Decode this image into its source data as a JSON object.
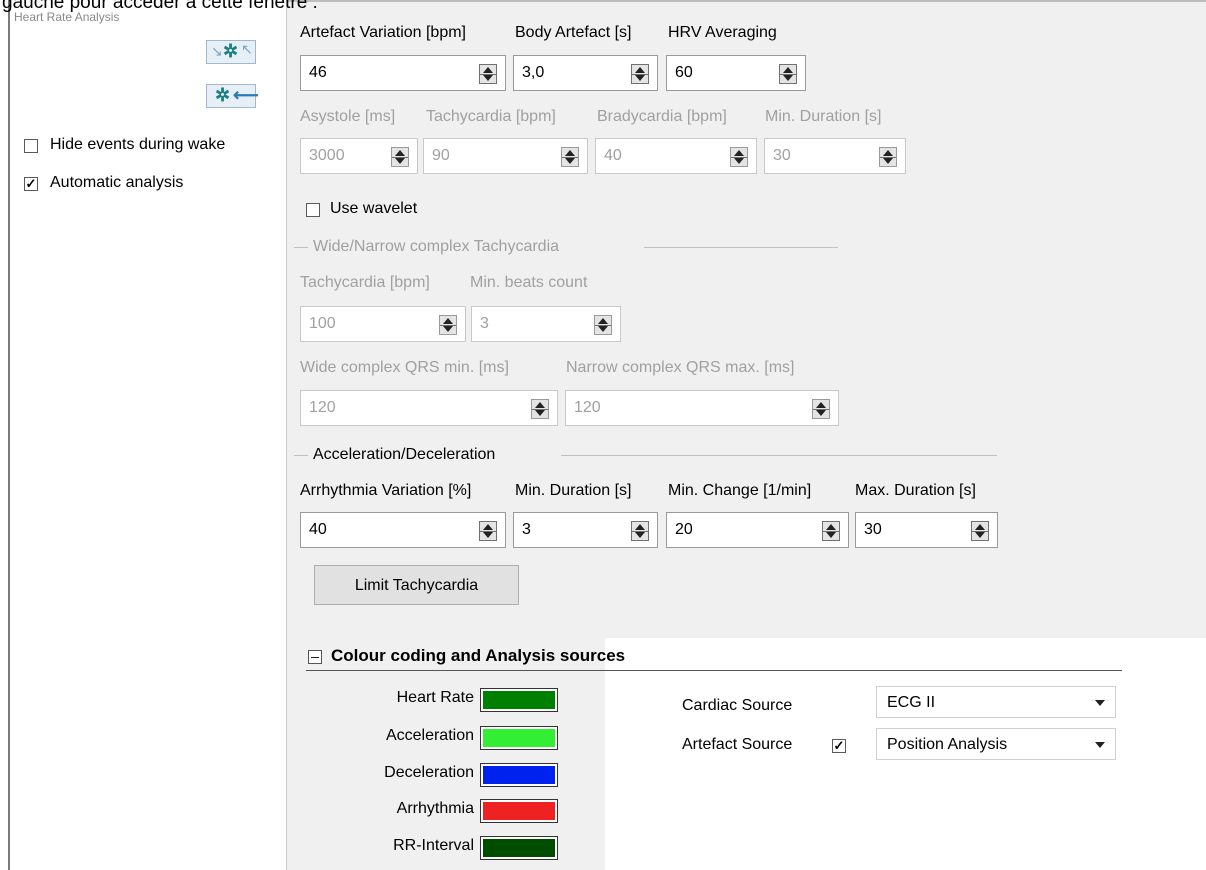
{
  "overlay_text": "gauche pour accéder à cette fenêtre :",
  "left_panel": {
    "title": "Heart Rate Analysis",
    "hide_events_label": "Hide events during wake",
    "hide_events_checked": false,
    "automatic_analysis_label": "Automatic analysis",
    "automatic_analysis_checked": true
  },
  "row1": {
    "labels": [
      "Artefact Variation [bpm]",
      "Body Artefact [s]",
      "HRV Averaging"
    ],
    "values": [
      "46",
      "3,0",
      "60"
    ]
  },
  "row2": {
    "labels": [
      "Asystole [ms]",
      "Tachycardia [bpm]",
      "Bradycardia [bpm]",
      "Min. Duration [s]"
    ],
    "values": [
      "3000",
      "90",
      "40",
      "30"
    ]
  },
  "use_wavelet": {
    "label": "Use wavelet",
    "checked": false
  },
  "wide_narrow": {
    "group_title": "Wide/Narrow complex Tachycardia",
    "labels_a": [
      "Tachycardia [bpm]",
      "Min. beats count"
    ],
    "values_a": [
      "100",
      "3"
    ],
    "labels_b": [
      "Wide complex QRS min. [ms]",
      "Narrow complex QRS max. [ms]"
    ],
    "values_b": [
      "120",
      "120"
    ]
  },
  "accel": {
    "group_title": "Acceleration/Deceleration",
    "labels": [
      "Arrhythmia Variation [%]",
      "Min. Duration [s]",
      "Min. Change [1/min]",
      "Max. Duration [s]"
    ],
    "values": [
      "40",
      "3",
      "20",
      "30"
    ]
  },
  "limit_button": "Limit Tachycardia",
  "colour_section": {
    "title": "Colour coding and Analysis sources",
    "items": [
      {
        "label": "Heart Rate",
        "color": "#008000"
      },
      {
        "label": "Acceleration",
        "color": "#33ee33"
      },
      {
        "label": "Deceleration",
        "color": "#0022ee"
      },
      {
        "label": "Arrhythmia",
        "color": "#ee2222"
      },
      {
        "label": "RR-Interval",
        "color": "#004d00"
      }
    ],
    "cardiac_source_label": "Cardiac Source",
    "cardiac_source_value": "ECG II",
    "artefact_source_label": "Artefact Source",
    "artefact_source_checked": true,
    "artefact_source_value": "Position Analysis"
  }
}
